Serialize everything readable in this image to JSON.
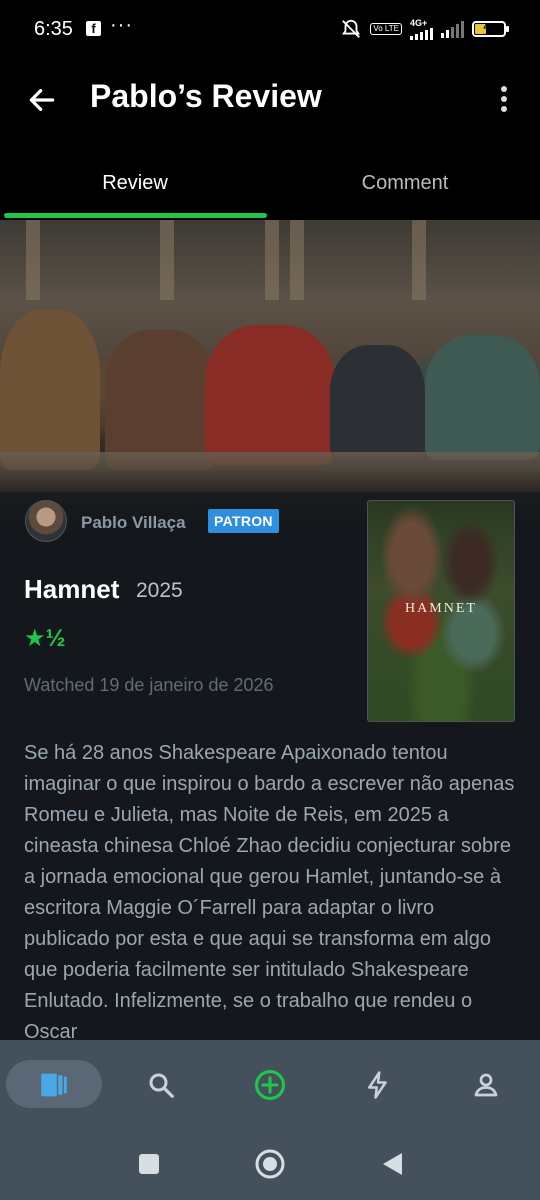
{
  "status_bar": {
    "time": "6:35",
    "app_icon": "facebook-icon",
    "more": "···",
    "volte": "Vo LTE",
    "network": "4G+",
    "battery": "40",
    "icons": [
      "mute-alarm-icon",
      "volte-icon",
      "signal-icon",
      "signal-icon",
      "battery-icon"
    ]
  },
  "appbar": {
    "title": "Pablo’s Review",
    "back_icon": "arrow-left-icon",
    "menu_icon": "more-vert-icon"
  },
  "tabs": [
    {
      "label": "Review",
      "active": true
    },
    {
      "label": "Comment",
      "active": false
    }
  ],
  "review": {
    "author": "Pablo Villaça",
    "badge": "PATRON",
    "film_title": "Hamnet",
    "year": "2025",
    "rating": "★½",
    "watched": "Watched 19 de janeiro de 2026",
    "poster_title": "HAMNET",
    "text": "Se há 28 anos Shakespeare Apaixonado tentou imaginar o que inspirou o bardo a escrever não apenas Romeu e Julieta, mas Noite de Reis, em 2025 a cineasta chinesa Chloé Zhao decidiu conjecturar sobre a jornada emocional que gerou Hamlet, juntando-se à escritora Maggie O´Farrell para adaptar o livro publicado por esta e que aqui se transforma em algo que poderia facilmente ser intitulado Shakespeare Enlutado. Infelizmente, se o trabalho que rendeu o Oscar"
  },
  "bottom_nav": [
    {
      "icon": "films-icon",
      "active": true
    },
    {
      "icon": "search-icon",
      "active": false
    },
    {
      "icon": "add-circle-icon",
      "active": false
    },
    {
      "icon": "activity-bolt-icon",
      "active": false
    },
    {
      "icon": "profile-icon",
      "active": false
    }
  ],
  "colors": {
    "accent_green": "#20c64a",
    "patron_blue": "#2e8fe0",
    "panel_bg": "#14181c",
    "nav_bg": "#44505c"
  }
}
